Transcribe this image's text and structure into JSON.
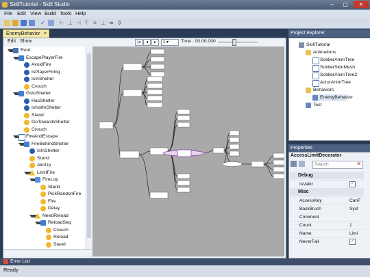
{
  "window": {
    "title": "SkillTutorial - Skill Studio",
    "min": "–",
    "max": "▢",
    "close": "✕"
  },
  "menu": [
    "File",
    "Edit",
    "View",
    "Build",
    "Tools",
    "Help"
  ],
  "doc_tab": {
    "label": "EnemyBehavior",
    "close": "×"
  },
  "edit_bar": {
    "edit": "Edit",
    "show": "Show"
  },
  "time_label": "Time : 00.00.000",
  "speed_value": "1",
  "tree": [
    {
      "label": "Root",
      "depth": 0,
      "icon": "root"
    },
    {
      "label": "EscapePlayerFire",
      "depth": 1,
      "icon": "seq"
    },
    {
      "label": "AvoidFire",
      "depth": 2,
      "icon": "cond"
    },
    {
      "label": "IsPlayerFiring",
      "depth": 2,
      "icon": "cond"
    },
    {
      "label": "IsInShelter",
      "depth": 2,
      "icon": "cond"
    },
    {
      "label": "Crouch",
      "depth": 2,
      "icon": "action"
    },
    {
      "label": "GotoShelter",
      "depth": 1,
      "icon": "seq"
    },
    {
      "label": "HasShelter",
      "depth": 2,
      "icon": "cond"
    },
    {
      "label": "IsNotInShelter",
      "depth": 2,
      "icon": "cond"
    },
    {
      "label": "Stand",
      "depth": 2,
      "icon": "action"
    },
    {
      "label": "GoTowardsShelter",
      "depth": 2,
      "icon": "action"
    },
    {
      "label": "Crouch",
      "depth": 2,
      "icon": "action"
    },
    {
      "label": "FireAndEscape",
      "depth": 1,
      "icon": "check"
    },
    {
      "label": "FireBehindShelter",
      "depth": 2,
      "icon": "seq"
    },
    {
      "label": "IsInShelter",
      "depth": 3,
      "icon": "cond"
    },
    {
      "label": "Stand",
      "depth": 3,
      "icon": "action"
    },
    {
      "label": "AimUp",
      "depth": 3,
      "icon": "action"
    },
    {
      "label": "LimitFire",
      "depth": 3,
      "icon": "warn"
    },
    {
      "label": "FireLop",
      "depth": 4,
      "icon": "loop"
    },
    {
      "label": "Stand",
      "depth": 5,
      "icon": "action"
    },
    {
      "label": "PickRandonFire",
      "depth": 5,
      "icon": "action"
    },
    {
      "label": "Fire",
      "depth": 5,
      "icon": "action"
    },
    {
      "label": "Delay",
      "depth": 5,
      "icon": "action"
    },
    {
      "label": "NeedReload",
      "depth": 4,
      "icon": "warn"
    },
    {
      "label": "ReloadSeq",
      "depth": 5,
      "icon": "seq"
    },
    {
      "label": "Crouch",
      "depth": 6,
      "icon": "action"
    },
    {
      "label": "Reload",
      "depth": 6,
      "icon": "action"
    },
    {
      "label": "Stand",
      "depth": 6,
      "icon": "action"
    }
  ],
  "project_explorer": {
    "title": "Project Explorer",
    "items": [
      {
        "label": "SkillTutorial",
        "depth": 0,
        "icon": "project"
      },
      {
        "label": "Animations",
        "depth": 1,
        "icon": "folder"
      },
      {
        "label": "SoldierAnimTree",
        "depth": 2,
        "icon": "anim"
      },
      {
        "label": "SoldierSkinMesh",
        "depth": 2,
        "icon": "anim"
      },
      {
        "label": "SoldierAnimTree2",
        "depth": 2,
        "icon": "anim"
      },
      {
        "label": "ActorAnimTree",
        "depth": 2,
        "icon": "anim"
      },
      {
        "label": "Behaviors",
        "depth": 1,
        "icon": "folder"
      },
      {
        "label": "EnemyBehavior",
        "depth": 2,
        "icon": "behavior"
      },
      {
        "label": "Test",
        "depth": 1,
        "icon": "behavior"
      }
    ]
  },
  "properties": {
    "title": "Properties",
    "object": "AccessLimitDecorator",
    "search_placeholder": "Search",
    "categories": [
      {
        "name": "Debug",
        "rows": [
          {
            "name": "IsValid",
            "value": "✓",
            "checkbox": true
          }
        ]
      },
      {
        "name": "Misc",
        "rows": [
          {
            "name": "AccessKey",
            "value": "CanF"
          },
          {
            "name": "BackBrush",
            "value": "Syst"
          },
          {
            "name": "Comment",
            "value": ""
          },
          {
            "name": "Count",
            "value": "1"
          },
          {
            "name": "Name",
            "value": "Limi"
          },
          {
            "name": "NeverFail",
            "value": "✓",
            "checkbox": true
          }
        ]
      }
    ]
  },
  "error_tab": "Error List",
  "status": "Ready",
  "colors": {
    "canvas": "#a9a9a9",
    "node": "#ffffff",
    "edge": "#333333",
    "selected_edge": "#8e44ad",
    "panel_header": "#4d6182"
  }
}
